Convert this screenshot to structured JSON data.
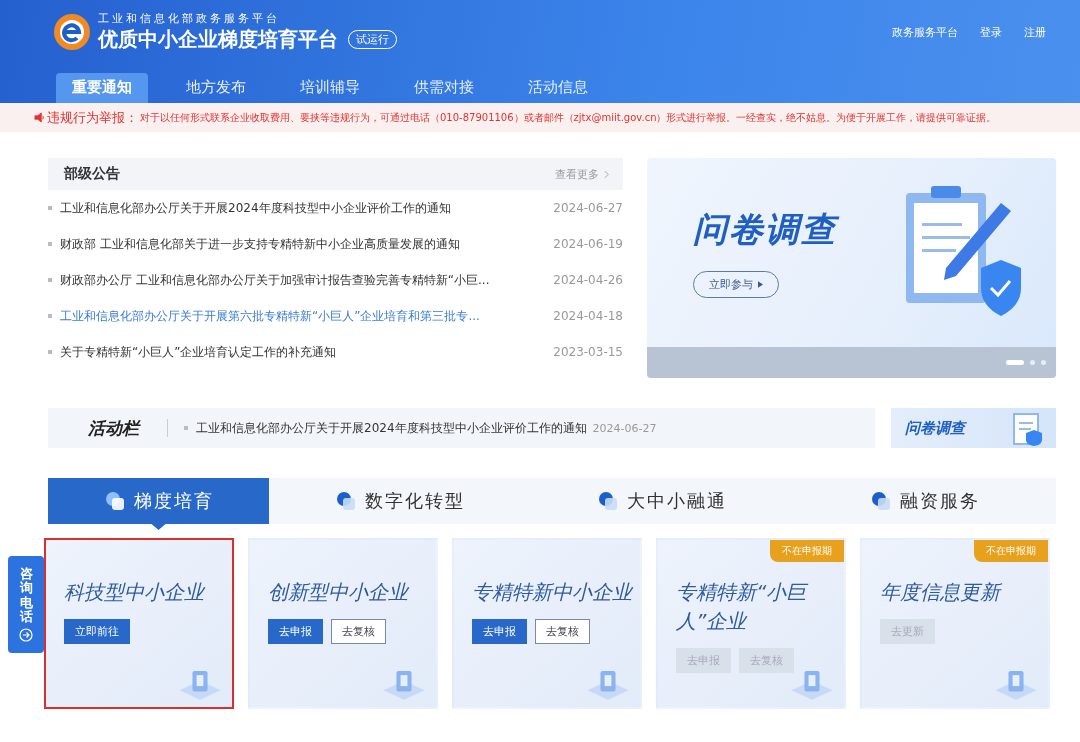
{
  "header": {
    "org": "工业和信息化部政务服务平台",
    "title": "优质中小企业梯度培育平台",
    "badge": "试运行",
    "links": [
      "政务服务平台",
      "登录",
      "注册"
    ]
  },
  "nav": [
    {
      "label": "重要通知",
      "selected": true
    },
    {
      "label": "地方发布",
      "selected": false
    },
    {
      "label": "培训辅导",
      "selected": false
    },
    {
      "label": "供需对接",
      "selected": false
    },
    {
      "label": "活动信息",
      "selected": false
    }
  ],
  "notice": {
    "label": "违规行为举报：",
    "text": "对于以任何形式联系企业收取费用、要挟等违规行为，可通过电话（010-87901106）或者邮件（zjtx@miit.gov.cn）形式进行举报。一经查实，绝不姑息。为便于开展工作，请提供可靠证据。"
  },
  "announcements": {
    "title": "部级公告",
    "more": "查看更多",
    "items": [
      {
        "title": "工业和信息化部办公厅关于开展2024年度科技型中小企业评价工作的通知",
        "date": "2024-06-27",
        "active": false
      },
      {
        "title": "财政部 工业和信息化部关于进一步支持专精特新中小企业高质量发展的通知",
        "date": "2024-06-19",
        "active": false
      },
      {
        "title": "财政部办公厅 工业和信息化部办公厅关于加强审计报告查验完善专精特新“小巨...",
        "date": "2024-04-26",
        "active": false
      },
      {
        "title": "工业和信息化部办公厅关于开展第六批专精特新“小巨人”企业培育和第三批专...",
        "date": "2024-04-18",
        "active": true
      },
      {
        "title": "关于专精特新“小巨人”企业培育认定工作的补充通知",
        "date": "2023-03-15",
        "active": false
      }
    ]
  },
  "banner": {
    "title": "问卷调查",
    "button": "立即参与",
    "dots": [
      {
        "selected": true
      },
      {
        "selected": false
      },
      {
        "selected": false
      }
    ]
  },
  "activity": {
    "title": "活动栏",
    "item_title": "工业和信息化部办公厅关于开展2024年度科技型中小企业评价工作的通知",
    "item_date": "2024-06-27"
  },
  "side_banner": {
    "title": "问卷调查"
  },
  "service_tabs": [
    {
      "label": "梯度培育",
      "selected": true
    },
    {
      "label": "数字化转型",
      "selected": false
    },
    {
      "label": "大中小融通",
      "selected": false
    },
    {
      "label": "融资服务",
      "selected": false
    }
  ],
  "cards": [
    {
      "title": "科技型中小企业",
      "highlighted": true,
      "buttons": [
        {
          "label": "立即前往",
          "kind": "primary"
        }
      ]
    },
    {
      "title": "创新型中小企业",
      "highlighted": false,
      "buttons": [
        {
          "label": "去申报",
          "kind": "primary"
        },
        {
          "label": "去复核",
          "kind": "outline"
        }
      ]
    },
    {
      "title": "专精特新中小企业",
      "highlighted": false,
      "buttons": [
        {
          "label": "去申报",
          "kind": "primary"
        },
        {
          "label": "去复核",
          "kind": "outline"
        }
      ]
    },
    {
      "title": "专精特新“小巨人”企业",
      "highlighted": false,
      "badge": "不在申报期",
      "buttons": [
        {
          "label": "去申报",
          "kind": "disabled"
        },
        {
          "label": "去复核",
          "kind": "disabled"
        }
      ]
    },
    {
      "title": "年度信息更新",
      "highlighted": false,
      "badge": "不在申报期",
      "buttons": [
        {
          "label": "去更新",
          "kind": "disabled"
        }
      ]
    }
  ],
  "consult": {
    "label": "咨询电话"
  }
}
